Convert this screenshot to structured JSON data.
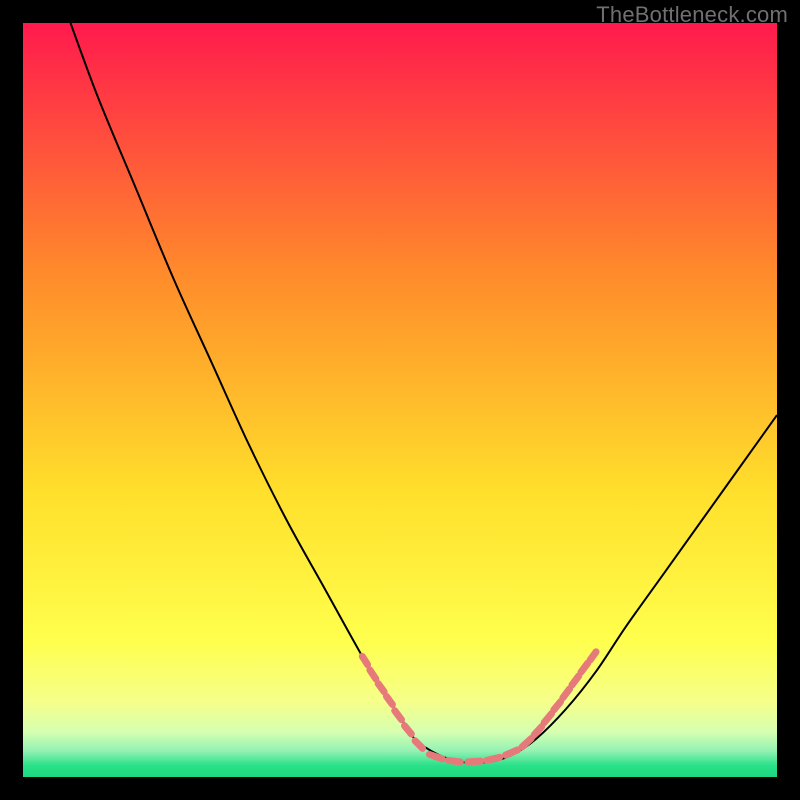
{
  "watermark": "TheBottleneck.com",
  "chart_data": {
    "type": "line",
    "title": "",
    "xlabel": "",
    "ylabel": "",
    "xlim": [
      0,
      100
    ],
    "ylim": [
      0,
      100
    ],
    "background_gradient": {
      "stops": [
        {
          "pos": 0.0,
          "color": "#ff1a4d"
        },
        {
          "pos": 0.33,
          "color": "#ff8a2b"
        },
        {
          "pos": 0.62,
          "color": "#ffdf2b"
        },
        {
          "pos": 0.82,
          "color": "#ffff4d"
        },
        {
          "pos": 0.9,
          "color": "#f5ff8a"
        },
        {
          "pos": 0.94,
          "color": "#d6ffb0"
        },
        {
          "pos": 0.965,
          "color": "#95f2b4"
        },
        {
          "pos": 0.985,
          "color": "#28e088"
        },
        {
          "pos": 1.0,
          "color": "#1cd980"
        }
      ]
    },
    "series": [
      {
        "name": "bottleneck-curve",
        "stroke": "#000000",
        "x": [
          6.3,
          10,
          15,
          20,
          25,
          30,
          35,
          40,
          45,
          48,
          50,
          52,
          55,
          58,
          60,
          62,
          65,
          68,
          72,
          76,
          80,
          85,
          90,
          95,
          100
        ],
        "y": [
          100,
          90,
          78,
          66,
          55,
          44,
          34,
          25,
          16,
          11,
          8,
          5,
          3,
          2,
          2,
          2,
          3,
          5,
          9,
          14,
          20,
          27,
          34,
          41,
          48
        ]
      }
    ],
    "highlight_segments": {
      "color": "#e67a7a",
      "width": 7,
      "segments": [
        {
          "x0": 45.0,
          "y0": 16.0,
          "x1": 45.7,
          "y1": 14.9
        },
        {
          "x0": 46.0,
          "y0": 14.2,
          "x1": 46.8,
          "y1": 13.0
        },
        {
          "x0": 47.1,
          "y0": 12.4,
          "x1": 47.9,
          "y1": 11.3
        },
        {
          "x0": 48.2,
          "y0": 10.7,
          "x1": 49.0,
          "y1": 9.6
        },
        {
          "x0": 49.3,
          "y0": 8.8,
          "x1": 50.2,
          "y1": 7.6
        },
        {
          "x0": 50.6,
          "y0": 6.8,
          "x1": 51.5,
          "y1": 5.7
        },
        {
          "x0": 52.0,
          "y0": 4.8,
          "x1": 53.0,
          "y1": 3.8
        },
        {
          "x0": 53.9,
          "y0": 3.0,
          "x1": 55.6,
          "y1": 2.4
        },
        {
          "x0": 56.4,
          "y0": 2.2,
          "x1": 58.0,
          "y1": 2.0
        },
        {
          "x0": 59.0,
          "y0": 2.0,
          "x1": 60.7,
          "y1": 2.1
        },
        {
          "x0": 61.5,
          "y0": 2.2,
          "x1": 63.2,
          "y1": 2.6
        },
        {
          "x0": 64.0,
          "y0": 2.9,
          "x1": 65.6,
          "y1": 3.6
        },
        {
          "x0": 66.2,
          "y0": 4.0,
          "x1": 67.4,
          "y1": 5.1
        },
        {
          "x0": 67.8,
          "y0": 5.6,
          "x1": 68.8,
          "y1": 6.7
        },
        {
          "x0": 69.1,
          "y0": 7.2,
          "x1": 70.1,
          "y1": 8.4
        },
        {
          "x0": 70.4,
          "y0": 8.9,
          "x1": 71.3,
          "y1": 10.0
        },
        {
          "x0": 71.6,
          "y0": 10.5,
          "x1": 72.5,
          "y1": 11.7
        },
        {
          "x0": 72.8,
          "y0": 12.2,
          "x1": 73.7,
          "y1": 13.4
        },
        {
          "x0": 74.0,
          "y0": 13.9,
          "x1": 74.9,
          "y1": 15.1
        },
        {
          "x0": 75.2,
          "y0": 15.5,
          "x1": 76.0,
          "y1": 16.6
        }
      ]
    }
  }
}
